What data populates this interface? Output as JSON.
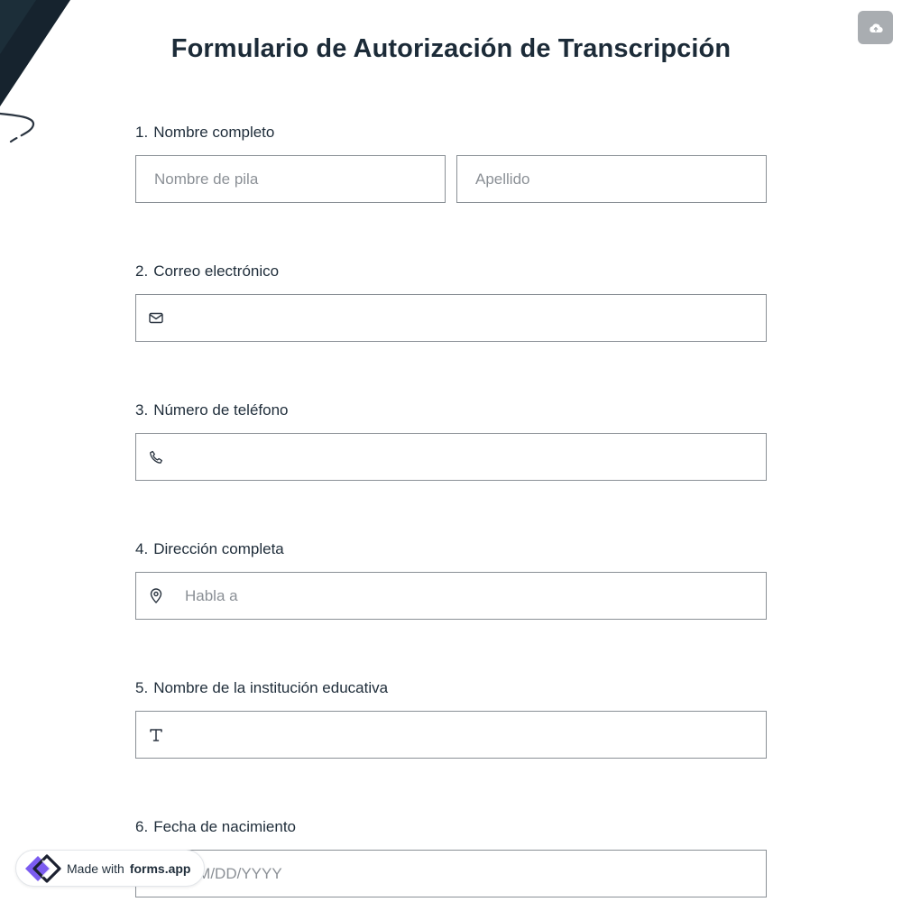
{
  "form": {
    "title": "Formulario de Autorización de Transcripción",
    "questions": [
      {
        "number": "1.",
        "label": "Nombre completo",
        "fields": [
          {
            "placeholder": "Nombre de pila",
            "value": ""
          },
          {
            "placeholder": "Apellido",
            "value": ""
          }
        ]
      },
      {
        "number": "2.",
        "label": "Correo electrónico",
        "icon": "envelope-icon",
        "placeholder": "",
        "value": ""
      },
      {
        "number": "3.",
        "label": "Número de teléfono",
        "icon": "phone-icon",
        "placeholder": "",
        "value": ""
      },
      {
        "number": "4.",
        "label": "Dirección completa",
        "icon": "map-pin-icon",
        "placeholder": "Habla a",
        "value": ""
      },
      {
        "number": "5.",
        "label": "Nombre de la institución educativa",
        "icon": "text-t-icon",
        "placeholder": "",
        "value": ""
      },
      {
        "number": "6.",
        "label": "Fecha de nacimiento",
        "icon": "calendar-icon",
        "placeholder": "MM/DD/YYYY",
        "value": ""
      }
    ]
  },
  "toolbar": {
    "save_icon": "cloud-upload-icon"
  },
  "badge": {
    "prefix": "Made with",
    "brand": "forms.app",
    "logo_icon": "forms-app-logo-icon"
  },
  "colors": {
    "title": "#1c2b38",
    "field_border": "#8a9096",
    "placeholder": "#8b9096",
    "save_button": "#a9adb1",
    "logo_purple": "#7b5cf0",
    "logo_dark": "#1b2030",
    "deco_dark": "#16232e"
  }
}
